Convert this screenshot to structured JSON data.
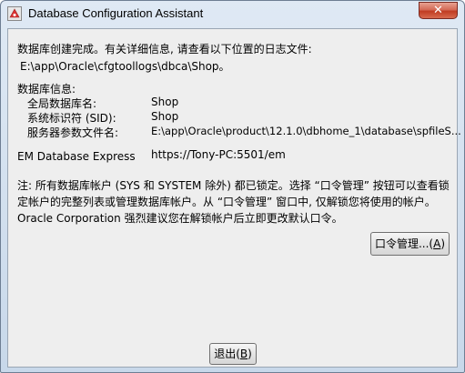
{
  "window": {
    "title": "Database Configuration Assistant",
    "close_label": "✕"
  },
  "message": {
    "line1": "数据库创建完成。有关详细信息, 请查看以下位置的日志文件:",
    "log_path": "E:\\app\\Oracle\\cfgtoollogs\\dbca\\Shop。"
  },
  "db_info": {
    "header": "数据库信息:",
    "rows": [
      {
        "label": "全局数据库名:",
        "value": "Shop"
      },
      {
        "label": "系统标识符 (SID):",
        "value": "Shop"
      },
      {
        "label": "服务器参数文件名:",
        "value": "E:\\app\\Oracle\\product\\12.1.0\\dbhome_1\\database\\spfileS..."
      }
    ]
  },
  "em": {
    "label": "EM Database Express",
    "url": "https://Tony-PC:5501/em"
  },
  "note": {
    "line1": "注: 所有数据库帐户 (SYS 和 SYSTEM 除外) 都已锁定。选择 “口令管理” 按钮可以查看锁",
    "line2": "定帐户的完整列表或管理数据库帐户。从 “口令管理” 窗口中, 仅解锁您将使用的帐户。",
    "line3": "Oracle Corporation 强烈建议您在解锁帐户后立即更改默认口令。"
  },
  "buttons": {
    "password_mgmt": {
      "label": "口令管理...(",
      "mnemonic": "A",
      "suffix": ")"
    },
    "exit": {
      "label": "退出(",
      "mnemonic": "B",
      "suffix": ")"
    }
  },
  "colors": {
    "close_red": "#c03c22",
    "panel_bg": "#eeeeee",
    "frame_blue": "#c8d8ea"
  },
  "icons": {
    "app": "oracle-dbca-icon",
    "close": "close-icon"
  }
}
